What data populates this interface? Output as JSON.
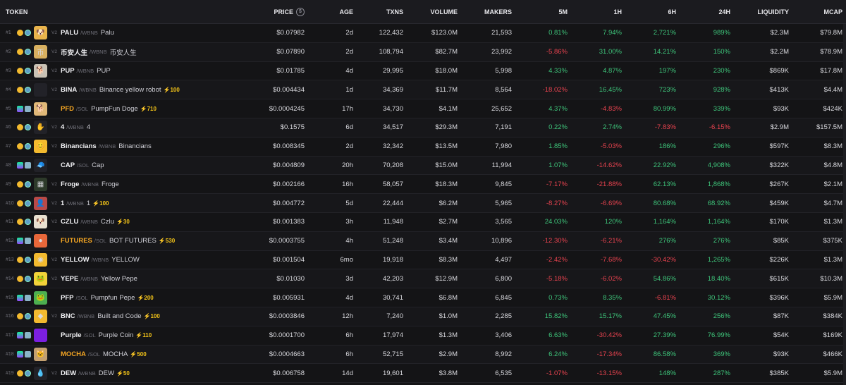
{
  "header": {
    "token": "TOKEN",
    "price": "PRICE",
    "price_icon": "$",
    "age": "AGE",
    "txns": "TXNS",
    "volume": "VOLUME",
    "makers": "MAKERS",
    "m5": "5M",
    "h1": "1H",
    "h6": "6H",
    "h24": "24H",
    "liquidity": "LIQUIDITY",
    "mcap": "MCAP"
  },
  "colors": {
    "up": "#3ec47a",
    "down": "#e8434f",
    "boost": "#f5c518",
    "hot_symbol": "#f5a623"
  },
  "rows": [
    {
      "rank": "#1",
      "chain": "bnb",
      "ver": "V2",
      "symbol": "PALU",
      "quote": "/WBNB",
      "name": "Palu",
      "boost": "",
      "hot": false,
      "price": "$0.07982",
      "age": "2d",
      "txns": "122,432",
      "volume": "$123.0M",
      "makers": "21,593",
      "m5": "0.81%",
      "h1": "7.94%",
      "h6": "2,721%",
      "h24": "989%",
      "liq": "$2.3M",
      "mcap": "$79.8M",
      "avatar": "#e9b44c",
      "glyph": "🐶"
    },
    {
      "rank": "#2",
      "chain": "bnb",
      "ver": "V2",
      "symbol": "币安人生",
      "quote": "/WBNB",
      "name": "币安人生",
      "boost": "",
      "hot": false,
      "price": "$0.07890",
      "age": "2d",
      "txns": "108,794",
      "volume": "$82.7M",
      "makers": "23,992",
      "m5": "-5.86%",
      "h1": "31.00%",
      "h6": "14.21%",
      "h24": "150%",
      "liq": "$2.2M",
      "mcap": "$78.9M",
      "avatar": "#d8b060",
      "glyph": "币"
    },
    {
      "rank": "#3",
      "chain": "bnb",
      "ver": "V2",
      "symbol": "PUP",
      "quote": "/WBNB",
      "name": "PUP",
      "boost": "",
      "hot": false,
      "price": "$0.01785",
      "age": "4d",
      "txns": "29,995",
      "volume": "$18.0M",
      "makers": "5,998",
      "m5": "4.33%",
      "h1": "4.87%",
      "h6": "197%",
      "h24": "230%",
      "liq": "$869K",
      "mcap": "$17.8M",
      "avatar": "#c9c2b5",
      "glyph": "🐕"
    },
    {
      "rank": "#4",
      "chain": "bnb",
      "ver": "V2",
      "symbol": "BINA",
      "quote": "/WBNB",
      "name": "Binance yellow robot",
      "boost": "⚡100",
      "hot": false,
      "price": "$0.004434",
      "age": "1d",
      "txns": "34,369",
      "volume": "$11.7M",
      "makers": "8,564",
      "m5": "-18.02%",
      "h1": "16.45%",
      "h6": "723%",
      "h24": "928%",
      "liq": "$413K",
      "mcap": "$4.4M",
      "avatar": "#222228",
      "glyph": ""
    },
    {
      "rank": "#5",
      "chain": "sol",
      "ver": "",
      "symbol": "PFD",
      "quote": "/SOL",
      "name": "PumpFun Doge",
      "boost": "⚡710",
      "hot": true,
      "price": "$0.0004245",
      "age": "17h",
      "txns": "34,730",
      "volume": "$4.1M",
      "makers": "25,652",
      "m5": "4.37%",
      "h1": "-4.83%",
      "h6": "80.99%",
      "h24": "339%",
      "liq": "$93K",
      "mcap": "$424K",
      "avatar": "#e0b878",
      "glyph": "🐕"
    },
    {
      "rank": "#6",
      "chain": "bnb",
      "ver": "V2",
      "symbol": "4",
      "quote": "/WBNB",
      "name": "4",
      "boost": "",
      "hot": false,
      "price": "$0.1575",
      "age": "6d",
      "txns": "34,517",
      "volume": "$29.3M",
      "makers": "7,191",
      "m5": "0.22%",
      "h1": "2.74%",
      "h6": "-7.83%",
      "h24": "-6.15%",
      "liq": "$2.9M",
      "mcap": "$157.5M",
      "avatar": "#222228",
      "glyph": "✋"
    },
    {
      "rank": "#7",
      "chain": "bnb",
      "ver": "V2",
      "symbol": "Binancians",
      "quote": "/WBNB",
      "name": "Binancians",
      "boost": "",
      "hot": false,
      "price": "$0.008345",
      "age": "2d",
      "txns": "32,342",
      "volume": "$13.5M",
      "makers": "7,980",
      "m5": "1.85%",
      "h1": "-5.03%",
      "h6": "186%",
      "h24": "296%",
      "liq": "$597K",
      "mcap": "$8.3M",
      "avatar": "#f3ba2f",
      "glyph": "😊"
    },
    {
      "rank": "#8",
      "chain": "sol",
      "ver": "",
      "symbol": "CAP",
      "quote": "/SOL",
      "name": "Cap",
      "boost": "",
      "hot": false,
      "price": "$0.004809",
      "age": "20h",
      "txns": "70,208",
      "volume": "$15.0M",
      "makers": "11,994",
      "m5": "1.07%",
      "h1": "-14.62%",
      "h6": "22.92%",
      "h24": "4,908%",
      "liq": "$322K",
      "mcap": "$4.8M",
      "avatar": "#222228",
      "glyph": "🧢"
    },
    {
      "rank": "#9",
      "chain": "bnb",
      "ver": "V2",
      "symbol": "Froge",
      "quote": "/WBNB",
      "name": "Froge",
      "boost": "",
      "hot": false,
      "price": "$0.002166",
      "age": "16h",
      "txns": "58,057",
      "volume": "$18.3M",
      "makers": "9,845",
      "m5": "-7.17%",
      "h1": "-21.88%",
      "h6": "62.13%",
      "h24": "1,868%",
      "liq": "$267K",
      "mcap": "$2.1M",
      "avatar": "#2d3a2a",
      "glyph": "▦"
    },
    {
      "rank": "#10",
      "chain": "bnb",
      "ver": "V2",
      "symbol": "1",
      "quote": "/WBNB",
      "name": "1",
      "boost": "⚡100",
      "hot": false,
      "price": "$0.004772",
      "age": "5d",
      "txns": "22,444",
      "volume": "$6.2M",
      "makers": "5,965",
      "m5": "-8.27%",
      "h1": "-6.69%",
      "h6": "80.68%",
      "h24": "68.92%",
      "liq": "$459K",
      "mcap": "$4.7M",
      "avatar": "#b94a48",
      "glyph": "👤"
    },
    {
      "rank": "#11",
      "chain": "bnb",
      "ver": "V2",
      "symbol": "CZLU",
      "quote": "/WBNB",
      "name": "Czlu",
      "boost": "⚡30",
      "hot": false,
      "price": "$0.001383",
      "age": "3h",
      "txns": "11,948",
      "volume": "$2.7M",
      "makers": "3,565",
      "m5": "24.03%",
      "h1": "120%",
      "h6": "1,164%",
      "h24": "1,164%",
      "liq": "$170K",
      "mcap": "$1.3M",
      "avatar": "#e8e0d0",
      "glyph": "🐶"
    },
    {
      "rank": "#12",
      "chain": "sol",
      "ver": "",
      "symbol": "FUTURES",
      "quote": "/SOL",
      "name": "BOT FUTURES",
      "boost": "⚡530",
      "hot": true,
      "price": "$0.0003755",
      "age": "4h",
      "txns": "51,248",
      "volume": "$3.4M",
      "makers": "10,896",
      "m5": "-12.30%",
      "h1": "-6.21%",
      "h6": "276%",
      "h24": "276%",
      "liq": "$85K",
      "mcap": "$375K",
      "avatar": "#e8673a",
      "glyph": "●"
    },
    {
      "rank": "#13",
      "chain": "bnb",
      "ver": "V2",
      "symbol": "YELLOW",
      "quote": "/WBNB",
      "name": "YELLOW",
      "boost": "",
      "hot": false,
      "price": "$0.001504",
      "age": "6mo",
      "txns": "19,918",
      "volume": "$8.3M",
      "makers": "4,497",
      "m5": "-2.42%",
      "h1": "-7.68%",
      "h6": "-30.42%",
      "h24": "1,265%",
      "liq": "$226K",
      "mcap": "$1.3M",
      "avatar": "#f3ba2f",
      "glyph": "◉"
    },
    {
      "rank": "#14",
      "chain": "bnb",
      "ver": "V2",
      "symbol": "YEPE",
      "quote": "/WBNB",
      "name": "Yellow Pepe",
      "boost": "",
      "hot": false,
      "price": "$0.01030",
      "age": "3d",
      "txns": "42,203",
      "volume": "$12.9M",
      "makers": "6,800",
      "m5": "-5.18%",
      "h1": "-6.02%",
      "h6": "54.86%",
      "h24": "18.40%",
      "liq": "$615K",
      "mcap": "$10.3M",
      "avatar": "#f3d23a",
      "glyph": "🐸"
    },
    {
      "rank": "#15",
      "chain": "sol",
      "ver": "",
      "symbol": "PFP",
      "quote": "/SOL",
      "name": "Pumpfun Pepe",
      "boost": "⚡200",
      "hot": false,
      "price": "$0.005931",
      "age": "4d",
      "txns": "30,741",
      "volume": "$6.8M",
      "makers": "6,845",
      "m5": "0.73%",
      "h1": "8.35%",
      "h6": "-6.81%",
      "h24": "30.12%",
      "liq": "$396K",
      "mcap": "$5.9M",
      "avatar": "#4caf50",
      "glyph": "🐸"
    },
    {
      "rank": "#16",
      "chain": "bnb",
      "ver": "V2",
      "symbol": "BNC",
      "quote": "/WBNB",
      "name": "Built and Code",
      "boost": "⚡100",
      "hot": false,
      "price": "$0.0003846",
      "age": "12h",
      "txns": "7,240",
      "volume": "$1.0M",
      "makers": "2,285",
      "m5": "15.82%",
      "h1": "15.17%",
      "h6": "47.45%",
      "h24": "256%",
      "liq": "$87K",
      "mcap": "$384K",
      "avatar": "#f3ba2f",
      "glyph": "◆"
    },
    {
      "rank": "#17",
      "chain": "sol",
      "ver": "",
      "symbol": "Purple",
      "quote": "/SOL",
      "name": "Purple Coin",
      "boost": "⚡110",
      "hot": false,
      "price": "$0.0001700",
      "age": "6h",
      "txns": "17,974",
      "volume": "$1.3M",
      "makers": "3,406",
      "m5": "6.63%",
      "h1": "-30.42%",
      "h6": "27.39%",
      "h24": "76.99%",
      "liq": "$54K",
      "mcap": "$169K",
      "avatar": "#7b1fe0",
      "glyph": ""
    },
    {
      "rank": "#18",
      "chain": "sol",
      "ver": "",
      "symbol": "MOCHA",
      "quote": "/SOL",
      "name": "MOCHA",
      "boost": "⚡500",
      "hot": true,
      "price": "$0.0004663",
      "age": "6h",
      "txns": "52,715",
      "volume": "$2.9M",
      "makers": "8,992",
      "m5": "6.24%",
      "h1": "-17.34%",
      "h6": "86.58%",
      "h24": "369%",
      "liq": "$93K",
      "mcap": "$466K",
      "avatar": "#c4a070",
      "glyph": "🐱"
    },
    {
      "rank": "#19",
      "chain": "bnb",
      "ver": "V2",
      "symbol": "DEW",
      "quote": "/WBNB",
      "name": "DEW",
      "boost": "⚡50",
      "hot": false,
      "price": "$0.006758",
      "age": "14d",
      "txns": "19,601",
      "volume": "$3.8M",
      "makers": "6,535",
      "m5": "-1.07%",
      "h1": "-13.15%",
      "h6": "148%",
      "h24": "287%",
      "liq": "$385K",
      "mcap": "$5.9M",
      "avatar": "#222228",
      "glyph": "💧"
    }
  ]
}
